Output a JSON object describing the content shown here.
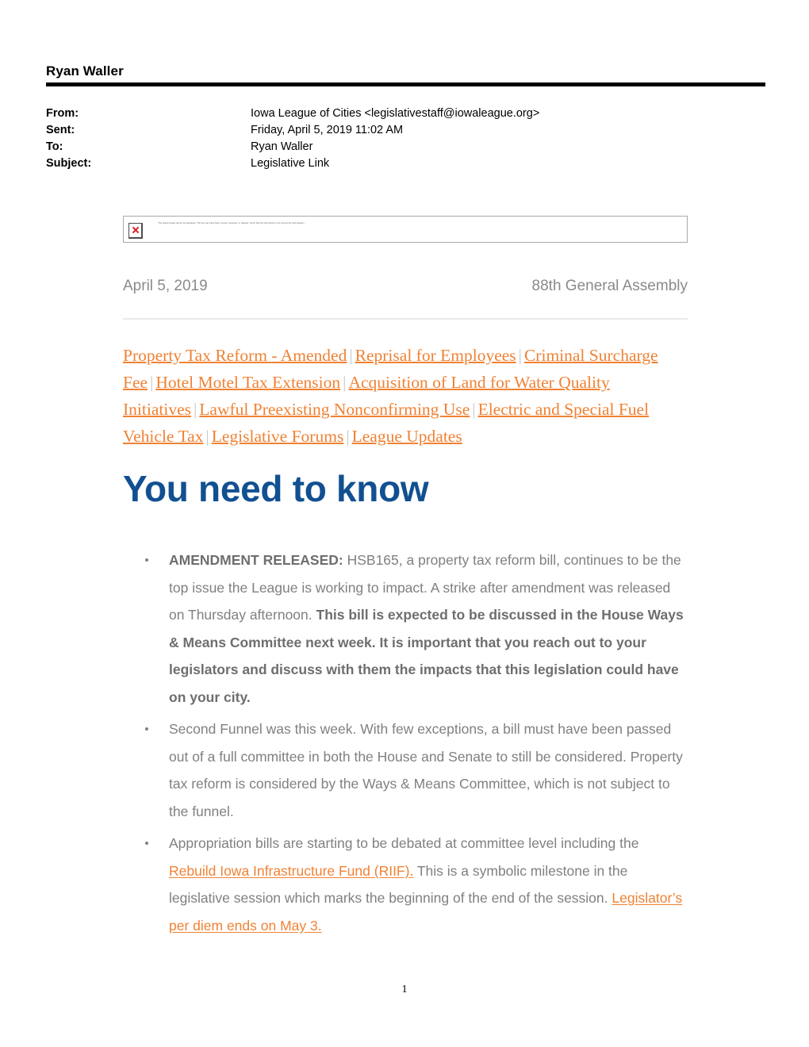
{
  "header": {
    "recipient_name": "Ryan Waller",
    "fields": [
      {
        "label": "From:",
        "value": "Iowa League of Cities <legislativestaff@iowaleague.org>"
      },
      {
        "label": "Sent:",
        "value": "Friday, April 5, 2019 11:02 AM"
      },
      {
        "label": "To:",
        "value": "Ryan Waller"
      },
      {
        "label": "Subject:",
        "value": "Legislative Link"
      }
    ]
  },
  "newsletter": {
    "broken_image_alt": "The linked image cannot be displayed. The file may have been moved, renamed, or deleted. Verify that the link points to the correct file and location.",
    "date": "April 5, 2019",
    "assembly": "88th General Assembly",
    "nav_links": [
      "Property Tax Reform - Amended",
      "Reprisal for Employees",
      "Criminal Surcharge Fee",
      "Hotel Motel Tax Extension",
      "Acquisition of Land for Water Quality Initiatives",
      "Lawful Preexisting Nonconfirming Use",
      "Electric and Special Fuel Vehicle Tax",
      "Legislative Forums",
      "League Updates"
    ],
    "nav_separator": "|",
    "title": "You need to know",
    "bullets": {
      "b1_lead": "AMENDMENT RELEASED:",
      "b1_text": " HSB165, a property tax reform bill, continues to be the top issue the League is working to impact. A strike after amendment was released on Thursday afternoon. ",
      "b1_bold": "This bill is expected to be discussed in the House Ways & Means Committee next week. It is important that you reach out to your legislators and discuss with them the impacts that this legislation could have on your city.",
      "b2_text": "Second Funnel was this week. With few exceptions, a bill must have been passed out of a full committee in both the House and Senate to still be considered. Property tax reform is considered by the Ways & Means Committee, which is not subject to the funnel.",
      "b3_part1": "Appropriation bills are starting to be debated at committee level including the ",
      "b3_link1": "Rebuild Iowa Infrastructure Fund (RIIF).",
      "b3_part2": " This is a symbolic milestone in the legislative session which marks the beginning of the end of the session. ",
      "b3_link2": "Legislator’s per diem ends on May 3."
    }
  },
  "footer": {
    "page_number": "1"
  },
  "colors": {
    "link_orange": "#F08234",
    "title_blue": "#115091",
    "body_gray": "#808080"
  }
}
